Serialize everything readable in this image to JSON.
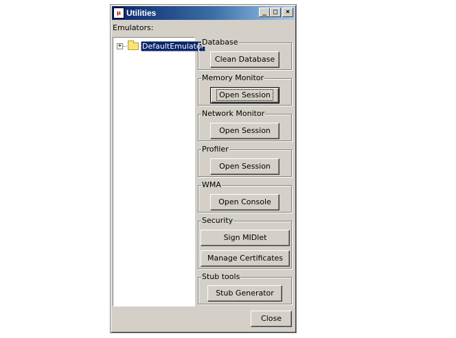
{
  "window": {
    "title": "Utilities",
    "icon_text": "μ"
  },
  "emulators": {
    "label": "Emulators:",
    "tree": [
      {
        "label": "DefaultEmulator",
        "expander": "+",
        "selected": true
      }
    ]
  },
  "groups": {
    "database": {
      "title": "Database",
      "button": "Clean Database"
    },
    "memory_monitor": {
      "title": "Memory Monitor",
      "button": "Open Session"
    },
    "network_monitor": {
      "title": "Network Monitor",
      "button": "Open Session"
    },
    "profiler": {
      "title": "Profiler",
      "button": "Open Session"
    },
    "wma": {
      "title": "WMA",
      "button": "Open Console"
    },
    "security": {
      "title": "Security",
      "button_sign": "Sign MIDlet",
      "button_certs": "Manage Certificates"
    },
    "stub_tools": {
      "title": "Stub tools",
      "button": "Stub Generator"
    }
  },
  "footer": {
    "close_label": "Close"
  },
  "icons": {
    "minimize": "minimize-icon",
    "maximize": "maximize-icon",
    "close": "close-icon",
    "folder": "folder-icon"
  },
  "colors": {
    "titlebar_start": "#0a246a",
    "titlebar_end": "#a6caf0",
    "face": "#d4d0c8",
    "selection": "#0a246a"
  }
}
